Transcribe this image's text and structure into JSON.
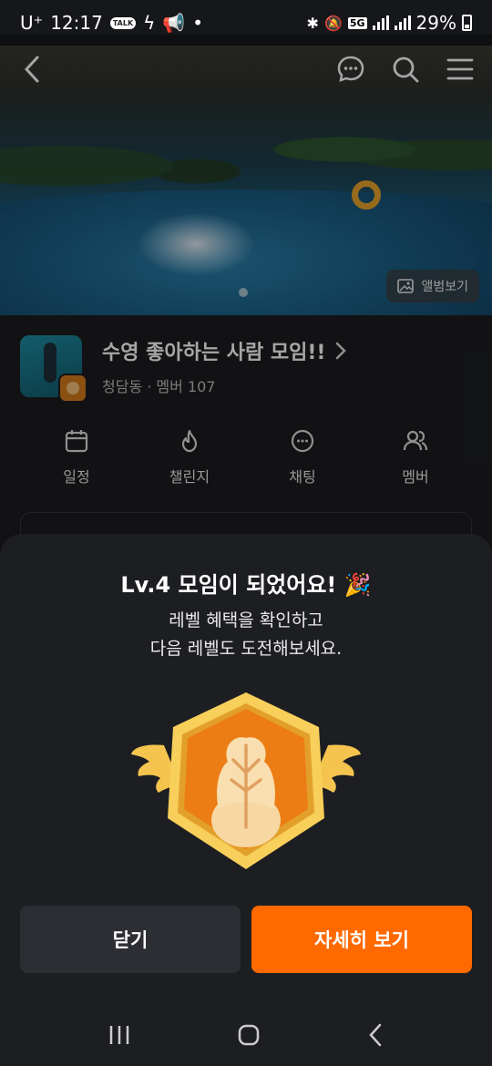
{
  "status_bar": {
    "carrier": "U⁺",
    "time": "12:17",
    "talk_badge": "TALK",
    "network": "5G",
    "battery": "29%"
  },
  "hero": {
    "album_label": "앨범보기"
  },
  "group": {
    "title": "수영 좋아하는 사람 모임!!",
    "subtitle": "청담동 · 멤버 107"
  },
  "menu": [
    {
      "label": "일정",
      "icon": "calendar-icon"
    },
    {
      "label": "챌린지",
      "icon": "flame-icon"
    },
    {
      "label": "채팅",
      "icon": "chat-icon"
    },
    {
      "label": "멤버",
      "icon": "members-icon"
    }
  ],
  "sheet": {
    "title": "Lv.4 모임이 되었어요! 🎉",
    "desc_line1": "레벨 혜택을 확인하고",
    "desc_line2": "다음 레벨도 도전해보세요.",
    "close_label": "닫기",
    "detail_label": "자세히 보기"
  },
  "colors": {
    "accent": "#ff6a00",
    "sheet_bg": "#1d1e22",
    "badge_gold": "#f4c44c",
    "badge_orange": "#e97a16"
  }
}
